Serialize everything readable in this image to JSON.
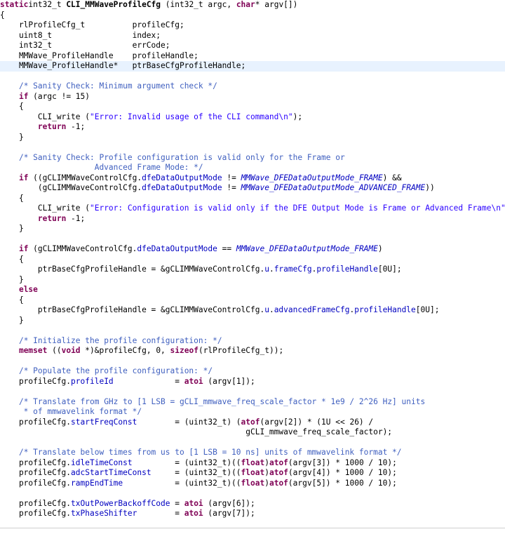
{
  "lines": [
    {
      "t": [
        [
          "kw",
          "static"
        ],
        [
          "",
          "int32_t "
        ],
        [
          "fn",
          "CLI_MMWaveProfileCfg"
        ],
        [
          "",
          " (int32_t argc, "
        ],
        [
          "kw",
          "char"
        ],
        [
          "",
          "* argv[])"
        ]
      ]
    },
    {
      "t": [
        [
          "",
          "{"
        ]
      ]
    },
    {
      "t": [
        [
          "",
          "    rlProfileCfg_t          profileCfg;"
        ]
      ]
    },
    {
      "t": [
        [
          "",
          "    uint8_t                 index;"
        ]
      ]
    },
    {
      "t": [
        [
          "",
          "    int32_t                 errCode;"
        ]
      ]
    },
    {
      "t": [
        [
          "",
          "    MMWave_ProfileHandle    profileHandle;"
        ]
      ]
    },
    {
      "hl": true,
      "t": [
        [
          "",
          "    MMWave_ProfileHandle*   ptrBaseCfgProfileHandle;"
        ]
      ]
    },
    {
      "t": []
    },
    {
      "t": [
        [
          "",
          "    "
        ],
        [
          "com",
          "/* Sanity Check: Minimum argument check */"
        ]
      ]
    },
    {
      "t": [
        [
          "",
          "    "
        ],
        [
          "kw",
          "if"
        ],
        [
          "",
          " (argc != 15)"
        ]
      ]
    },
    {
      "t": [
        [
          "",
          "    {"
        ]
      ]
    },
    {
      "t": [
        [
          "",
          "        CLI_write ("
        ],
        [
          "str",
          "\"Error: Invalid usage of the CLI command\\n\""
        ],
        [
          "",
          ");"
        ]
      ]
    },
    {
      "t": [
        [
          "",
          "        "
        ],
        [
          "kw",
          "return"
        ],
        [
          "",
          " -1;"
        ]
      ]
    },
    {
      "t": [
        [
          "",
          "    }"
        ]
      ]
    },
    {
      "t": []
    },
    {
      "t": [
        [
          "",
          "    "
        ],
        [
          "com",
          "/* Sanity Check: Profile configuration is valid only for the Frame or"
        ]
      ]
    },
    {
      "t": [
        [
          "com",
          "                    Advanced Frame Mode: */"
        ]
      ]
    },
    {
      "t": [
        [
          "",
          "    "
        ],
        [
          "kw",
          "if"
        ],
        [
          "",
          " ((gCLIMMWaveControlCfg."
        ],
        [
          "fld",
          "dfeDataOutputMode"
        ],
        [
          "",
          " != "
        ],
        [
          "en",
          "MMWave_DFEDataOutputMode_FRAME"
        ],
        [
          "",
          ") &&"
        ]
      ]
    },
    {
      "t": [
        [
          "",
          "        (gCLIMMWaveControlCfg."
        ],
        [
          "fld",
          "dfeDataOutputMode"
        ],
        [
          "",
          " != "
        ],
        [
          "en",
          "MMWave_DFEDataOutputMode_ADVANCED_FRAME"
        ],
        [
          "",
          "))"
        ]
      ]
    },
    {
      "t": [
        [
          "",
          "    {"
        ]
      ]
    },
    {
      "t": [
        [
          "",
          "        CLI_write ("
        ],
        [
          "str",
          "\"Error: Configuration is valid only if the DFE Output Mode is Frame or Advanced Frame\\n\""
        ],
        [
          "",
          ");"
        ]
      ]
    },
    {
      "t": [
        [
          "",
          "        "
        ],
        [
          "kw",
          "return"
        ],
        [
          "",
          " -1;"
        ]
      ]
    },
    {
      "t": [
        [
          "",
          "    }"
        ]
      ]
    },
    {
      "t": []
    },
    {
      "t": [
        [
          "",
          "    "
        ],
        [
          "kw",
          "if"
        ],
        [
          "",
          " (gCLIMMWaveControlCfg."
        ],
        [
          "fld",
          "dfeDataOutputMode"
        ],
        [
          "",
          " == "
        ],
        [
          "en",
          "MMWave_DFEDataOutputMode_FRAME"
        ],
        [
          "",
          ")"
        ]
      ]
    },
    {
      "t": [
        [
          "",
          "    {"
        ]
      ]
    },
    {
      "t": [
        [
          "",
          "        ptrBaseCfgProfileHandle = &gCLIMMWaveControlCfg."
        ],
        [
          "fld",
          "u"
        ],
        [
          "",
          "."
        ],
        [
          "fld",
          "frameCfg"
        ],
        [
          "",
          "."
        ],
        [
          "fld",
          "profileHandle"
        ],
        [
          "",
          "[0U];"
        ]
      ]
    },
    {
      "t": [
        [
          "",
          "    }"
        ]
      ]
    },
    {
      "t": [
        [
          "",
          "    "
        ],
        [
          "kw",
          "else"
        ]
      ]
    },
    {
      "t": [
        [
          "",
          "    {"
        ]
      ]
    },
    {
      "t": [
        [
          "",
          "        ptrBaseCfgProfileHandle = &gCLIMMWaveControlCfg."
        ],
        [
          "fld",
          "u"
        ],
        [
          "",
          "."
        ],
        [
          "fld",
          "advancedFrameCfg"
        ],
        [
          "",
          "."
        ],
        [
          "fld",
          "profileHandle"
        ],
        [
          "",
          "[0U];"
        ]
      ]
    },
    {
      "t": [
        [
          "",
          "    }"
        ]
      ]
    },
    {
      "t": []
    },
    {
      "t": [
        [
          "",
          "    "
        ],
        [
          "com",
          "/* Initialize the profile configuration: */"
        ]
      ]
    },
    {
      "t": [
        [
          "",
          "    "
        ],
        [
          "kw",
          "memset"
        ],
        [
          "",
          " (("
        ],
        [
          "kw",
          "void"
        ],
        [
          "",
          " *)&profileCfg, 0, "
        ],
        [
          "kw",
          "sizeof"
        ],
        [
          "",
          "(rlProfileCfg_t));"
        ]
      ]
    },
    {
      "t": []
    },
    {
      "t": [
        [
          "",
          "    "
        ],
        [
          "com",
          "/* Populate the profile configuration: */"
        ]
      ]
    },
    {
      "t": [
        [
          "",
          "    profileCfg."
        ],
        [
          "fld",
          "profileId"
        ],
        [
          "",
          "             = "
        ],
        [
          "kw",
          "atoi"
        ],
        [
          "",
          " (argv[1]);"
        ]
      ]
    },
    {
      "t": []
    },
    {
      "t": [
        [
          "",
          "    "
        ],
        [
          "com",
          "/* Translate from GHz to [1 LSB = gCLI_mmwave_freq_scale_factor * 1e9 / 2^26 Hz] units"
        ]
      ]
    },
    {
      "t": [
        [
          "com",
          "     * of mmwavelink format */"
        ]
      ]
    },
    {
      "t": [
        [
          "",
          "    profileCfg."
        ],
        [
          "fld",
          "startFreqConst"
        ],
        [
          "",
          "        = (uint32_t) ("
        ],
        [
          "kw",
          "atof"
        ],
        [
          "",
          "(argv[2]) * (1U << 26) /"
        ]
      ]
    },
    {
      "t": [
        [
          "",
          "                                                    gCLI_mmwave_freq_scale_factor);"
        ]
      ]
    },
    {
      "t": []
    },
    {
      "t": [
        [
          "",
          "    "
        ],
        [
          "com",
          "/* Translate below times from us to [1 LSB = 10 ns] units of mmwavelink format */"
        ]
      ]
    },
    {
      "t": [
        [
          "",
          "    profileCfg."
        ],
        [
          "fld",
          "idleTimeConst"
        ],
        [
          "",
          "         = (uint32_t)(("
        ],
        [
          "kw",
          "float"
        ],
        [
          "",
          ")"
        ],
        [
          "kw",
          "atof"
        ],
        [
          "",
          "(argv[3]) * 1000 / 10);"
        ]
      ]
    },
    {
      "t": [
        [
          "",
          "    profileCfg."
        ],
        [
          "fld",
          "adcStartTimeConst"
        ],
        [
          "",
          "     = (uint32_t)(("
        ],
        [
          "kw",
          "float"
        ],
        [
          "",
          ")"
        ],
        [
          "kw",
          "atof"
        ],
        [
          "",
          "(argv[4]) * 1000 / 10);"
        ]
      ]
    },
    {
      "t": [
        [
          "",
          "    profileCfg."
        ],
        [
          "fld",
          "rampEndTime"
        ],
        [
          "",
          "           = (uint32_t)(("
        ],
        [
          "kw",
          "float"
        ],
        [
          "",
          ")"
        ],
        [
          "kw",
          "atof"
        ],
        [
          "",
          "(argv[5]) * 1000 / 10);"
        ]
      ]
    },
    {
      "t": []
    },
    {
      "t": [
        [
          "",
          "    profileCfg."
        ],
        [
          "fld",
          "txOutPowerBackoffCode"
        ],
        [
          "",
          " = "
        ],
        [
          "kw",
          "atoi"
        ],
        [
          "",
          " (argv[6]);"
        ]
      ]
    },
    {
      "t": [
        [
          "",
          "    profileCfg."
        ],
        [
          "fld",
          "txPhaseShifter"
        ],
        [
          "",
          "        = "
        ],
        [
          "kw",
          "atoi"
        ],
        [
          "",
          " (argv[7]);"
        ]
      ]
    }
  ]
}
